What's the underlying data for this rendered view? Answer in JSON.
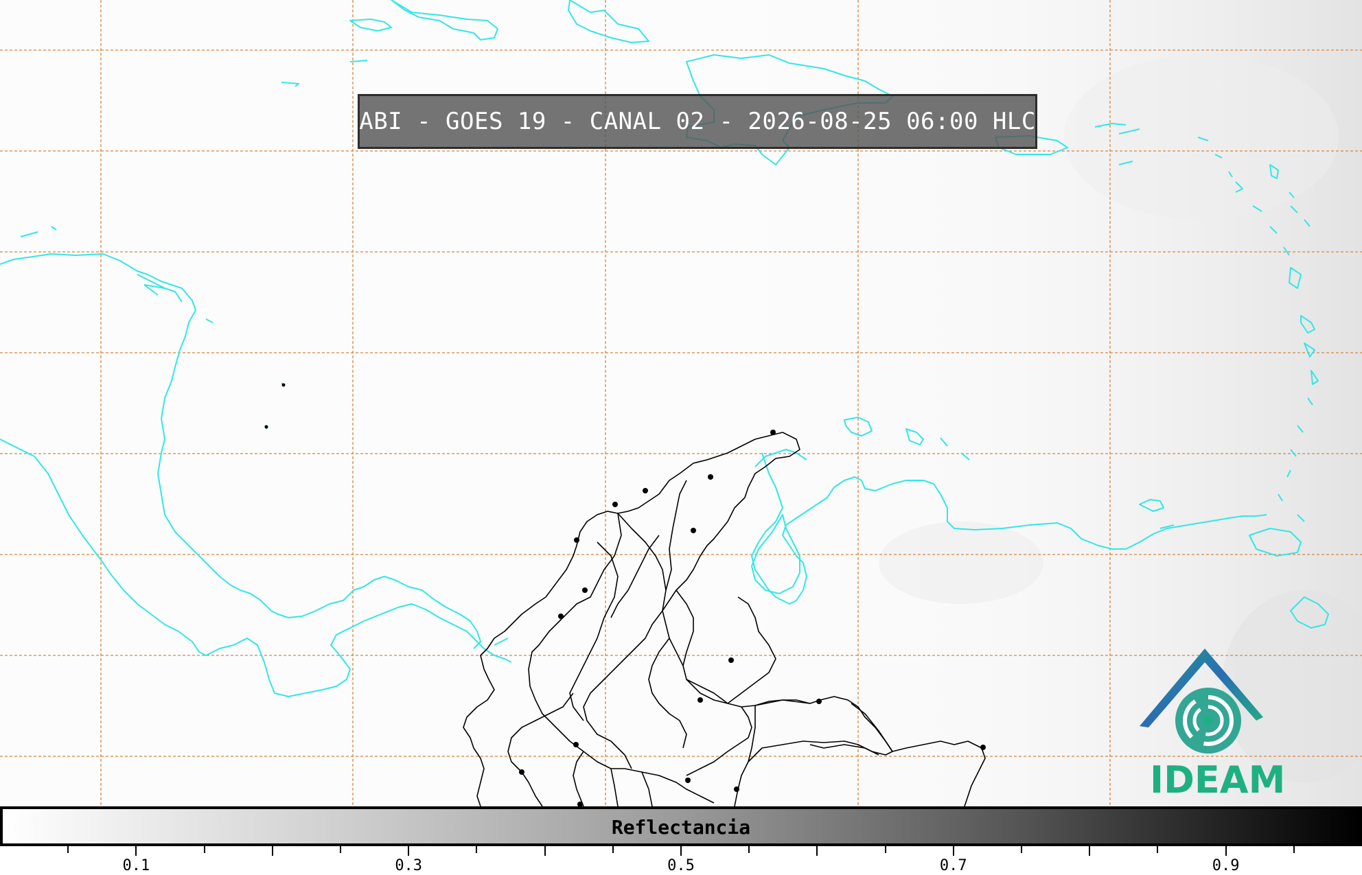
{
  "title": "ABI - GOES 19 - CANAL 02 - 2026-08-25 06:00 HLC",
  "colorbar": {
    "label": "Reflectancia",
    "tick_labels": [
      "0.1",
      "0.3",
      "0.5",
      "0.7",
      "0.9"
    ],
    "range": [
      0.0,
      1.0
    ],
    "colormap": "white-to-black",
    "colors": {
      "low": "#ffffff",
      "high": "#000000"
    }
  },
  "map": {
    "grid_color": "#d9833a",
    "coastline_color": "#33e6e6",
    "border_color": "#000000",
    "graticule_style": "dashed"
  },
  "logo": {
    "name": "ideam-logo",
    "text": "IDEAM",
    "colors": {
      "roof": "#2a6db3",
      "swirl": "#1fb082"
    }
  }
}
